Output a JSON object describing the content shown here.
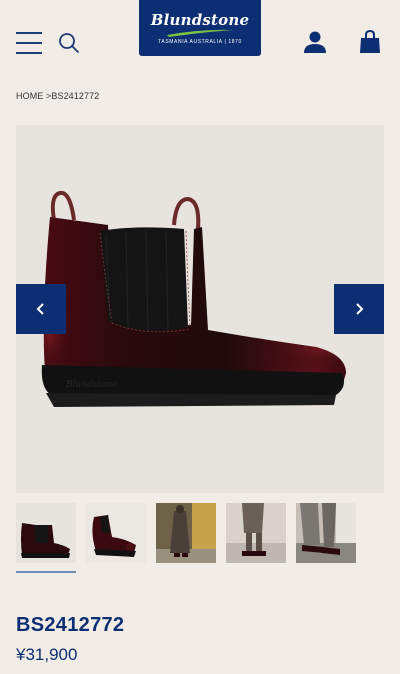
{
  "header": {
    "menu_icon": "hamburger-menu-icon",
    "search_icon": "search-icon",
    "account_icon": "account-icon",
    "cart_icon": "shopping-bag-icon",
    "logo": {
      "wordmark": "Blundstone",
      "tagline": "TASMANIA AUSTRALIA | 1870",
      "brand_color": "#0c2f73",
      "accent_color": "#7dc242"
    }
  },
  "breadcrumb": {
    "home": "HOME",
    "separator": " >",
    "current": "BS2412772"
  },
  "gallery": {
    "prev_icon": "chevron-left-icon",
    "next_icon": "chevron-right-icon",
    "thumbnails": [
      {
        "label": "boot-side-view",
        "selected": true
      },
      {
        "label": "boot-angle-view",
        "selected": false
      },
      {
        "label": "model-standing-shop",
        "selected": false
      },
      {
        "label": "model-legs-steps",
        "selected": false
      },
      {
        "label": "model-feet-closeup",
        "selected": false
      }
    ]
  },
  "product": {
    "name": "BS2412772",
    "price": "¥31,900"
  }
}
